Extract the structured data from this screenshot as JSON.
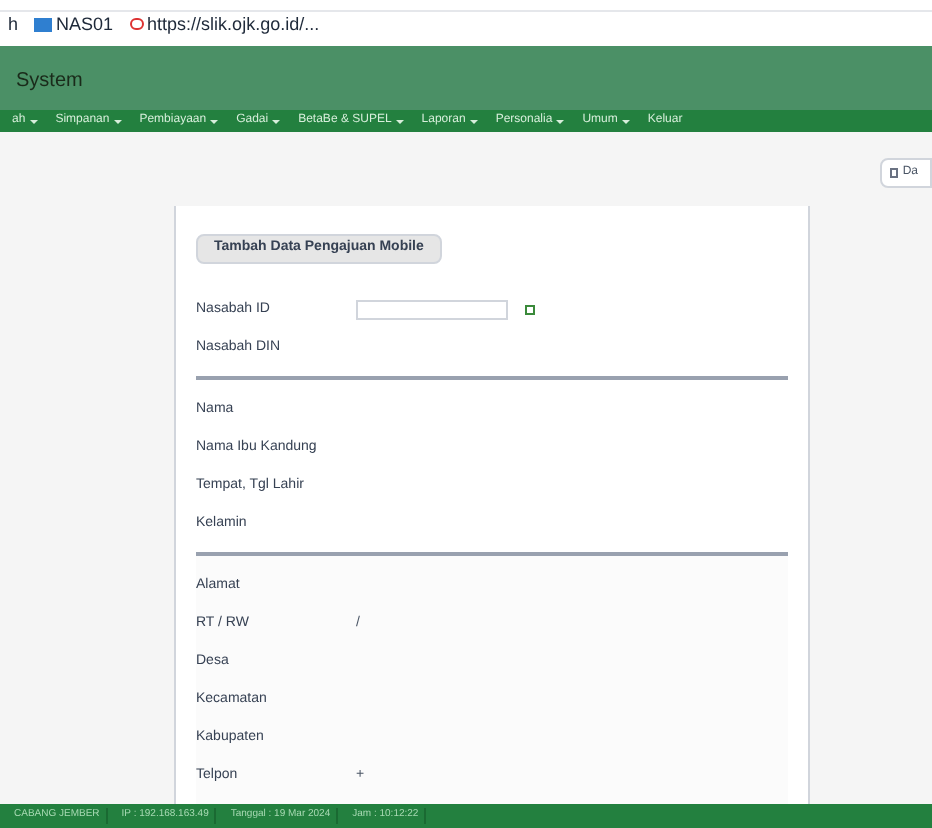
{
  "bookmarks": [
    {
      "label": "h",
      "kind": "text"
    },
    {
      "label": "NAS01",
      "kind": "app"
    },
    {
      "label": "https://slik.ojk.go.id/...",
      "kind": "ojk"
    }
  ],
  "header": {
    "title": "System"
  },
  "nav": [
    {
      "label": "ah",
      "caret": true
    },
    {
      "label": "Simpanan",
      "caret": true
    },
    {
      "label": "Pembiayaan",
      "caret": true
    },
    {
      "label": "Gadai",
      "caret": true
    },
    {
      "label": "BetaBe & SUPEL",
      "caret": true
    },
    {
      "label": "Laporan",
      "caret": true
    },
    {
      "label": "Personalia",
      "caret": true
    },
    {
      "label": "Umum",
      "caret": true
    },
    {
      "label": "Keluar",
      "caret": false
    }
  ],
  "top_button": {
    "label": "Da"
  },
  "form": {
    "tab": "Tambah Data Pengajuan Mobile",
    "sections": [
      [
        {
          "label": "Nasabah ID",
          "kind": "search"
        },
        {
          "label": "Nasabah DIN",
          "kind": "text"
        }
      ],
      [
        {
          "label": "Nama",
          "kind": "text"
        },
        {
          "label": "Nama Ibu Kandung",
          "kind": "text"
        },
        {
          "label": "Tempat, Tgl Lahir",
          "kind": "text"
        },
        {
          "label": "Kelamin",
          "kind": "text"
        }
      ],
      [
        {
          "label": "Alamat",
          "kind": "text"
        },
        {
          "label": "RT / RW",
          "kind": "text",
          "value": "/"
        },
        {
          "label": "Desa",
          "kind": "text"
        },
        {
          "label": "Kecamatan",
          "kind": "text"
        },
        {
          "label": "Kabupaten",
          "kind": "text"
        },
        {
          "label": "Telpon",
          "kind": "text",
          "value": "+"
        }
      ]
    ]
  },
  "status_bar": [
    "CABANG JEMBER",
    "IP : 192.168.163.49",
    "Tanggal : 19 Mar 2024",
    "Jam : 10:12:22"
  ]
}
